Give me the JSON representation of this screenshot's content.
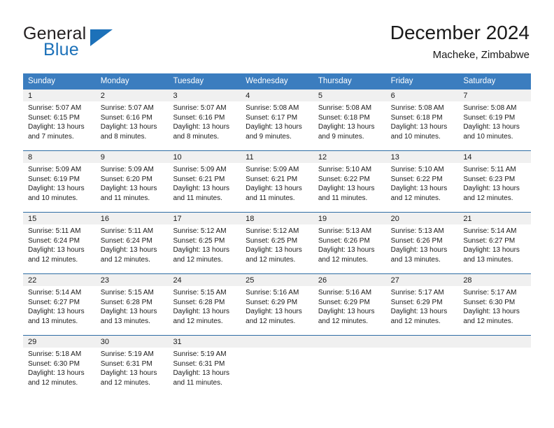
{
  "brand": {
    "name_top": "General",
    "name_bottom": "Blue",
    "triangle_icon": "blue-triangle-logo",
    "colors": {
      "blue": "#1c71b9",
      "black": "#231f20"
    }
  },
  "header": {
    "title": "December 2024",
    "subtitle": "Macheke, Zimbabwe"
  },
  "calendar": {
    "colors": {
      "header_blue": "#3b7dbf",
      "row_divider_blue": "#2e6da4",
      "day_band_gray": "#f0f0f0"
    },
    "weekdays": [
      "Sunday",
      "Monday",
      "Tuesday",
      "Wednesday",
      "Thursday",
      "Friday",
      "Saturday"
    ],
    "weeks": [
      [
        {
          "day": "1",
          "sunrise": "Sunrise: 5:07 AM",
          "sunset": "Sunset: 6:15 PM",
          "daylight_line1": "Daylight: 13 hours",
          "daylight_line2": "and 7 minutes."
        },
        {
          "day": "2",
          "sunrise": "Sunrise: 5:07 AM",
          "sunset": "Sunset: 6:16 PM",
          "daylight_line1": "Daylight: 13 hours",
          "daylight_line2": "and 8 minutes."
        },
        {
          "day": "3",
          "sunrise": "Sunrise: 5:07 AM",
          "sunset": "Sunset: 6:16 PM",
          "daylight_line1": "Daylight: 13 hours",
          "daylight_line2": "and 8 minutes."
        },
        {
          "day": "4",
          "sunrise": "Sunrise: 5:08 AM",
          "sunset": "Sunset: 6:17 PM",
          "daylight_line1": "Daylight: 13 hours",
          "daylight_line2": "and 9 minutes."
        },
        {
          "day": "5",
          "sunrise": "Sunrise: 5:08 AM",
          "sunset": "Sunset: 6:18 PM",
          "daylight_line1": "Daylight: 13 hours",
          "daylight_line2": "and 9 minutes."
        },
        {
          "day": "6",
          "sunrise": "Sunrise: 5:08 AM",
          "sunset": "Sunset: 6:18 PM",
          "daylight_line1": "Daylight: 13 hours",
          "daylight_line2": "and 10 minutes."
        },
        {
          "day": "7",
          "sunrise": "Sunrise: 5:08 AM",
          "sunset": "Sunset: 6:19 PM",
          "daylight_line1": "Daylight: 13 hours",
          "daylight_line2": "and 10 minutes."
        }
      ],
      [
        {
          "day": "8",
          "sunrise": "Sunrise: 5:09 AM",
          "sunset": "Sunset: 6:19 PM",
          "daylight_line1": "Daylight: 13 hours",
          "daylight_line2": "and 10 minutes."
        },
        {
          "day": "9",
          "sunrise": "Sunrise: 5:09 AM",
          "sunset": "Sunset: 6:20 PM",
          "daylight_line1": "Daylight: 13 hours",
          "daylight_line2": "and 11 minutes."
        },
        {
          "day": "10",
          "sunrise": "Sunrise: 5:09 AM",
          "sunset": "Sunset: 6:21 PM",
          "daylight_line1": "Daylight: 13 hours",
          "daylight_line2": "and 11 minutes."
        },
        {
          "day": "11",
          "sunrise": "Sunrise: 5:09 AM",
          "sunset": "Sunset: 6:21 PM",
          "daylight_line1": "Daylight: 13 hours",
          "daylight_line2": "and 11 minutes."
        },
        {
          "day": "12",
          "sunrise": "Sunrise: 5:10 AM",
          "sunset": "Sunset: 6:22 PM",
          "daylight_line1": "Daylight: 13 hours",
          "daylight_line2": "and 11 minutes."
        },
        {
          "day": "13",
          "sunrise": "Sunrise: 5:10 AM",
          "sunset": "Sunset: 6:22 PM",
          "daylight_line1": "Daylight: 13 hours",
          "daylight_line2": "and 12 minutes."
        },
        {
          "day": "14",
          "sunrise": "Sunrise: 5:11 AM",
          "sunset": "Sunset: 6:23 PM",
          "daylight_line1": "Daylight: 13 hours",
          "daylight_line2": "and 12 minutes."
        }
      ],
      [
        {
          "day": "15",
          "sunrise": "Sunrise: 5:11 AM",
          "sunset": "Sunset: 6:24 PM",
          "daylight_line1": "Daylight: 13 hours",
          "daylight_line2": "and 12 minutes."
        },
        {
          "day": "16",
          "sunrise": "Sunrise: 5:11 AM",
          "sunset": "Sunset: 6:24 PM",
          "daylight_line1": "Daylight: 13 hours",
          "daylight_line2": "and 12 minutes."
        },
        {
          "day": "17",
          "sunrise": "Sunrise: 5:12 AM",
          "sunset": "Sunset: 6:25 PM",
          "daylight_line1": "Daylight: 13 hours",
          "daylight_line2": "and 12 minutes."
        },
        {
          "day": "18",
          "sunrise": "Sunrise: 5:12 AM",
          "sunset": "Sunset: 6:25 PM",
          "daylight_line1": "Daylight: 13 hours",
          "daylight_line2": "and 12 minutes."
        },
        {
          "day": "19",
          "sunrise": "Sunrise: 5:13 AM",
          "sunset": "Sunset: 6:26 PM",
          "daylight_line1": "Daylight: 13 hours",
          "daylight_line2": "and 12 minutes."
        },
        {
          "day": "20",
          "sunrise": "Sunrise: 5:13 AM",
          "sunset": "Sunset: 6:26 PM",
          "daylight_line1": "Daylight: 13 hours",
          "daylight_line2": "and 13 minutes."
        },
        {
          "day": "21",
          "sunrise": "Sunrise: 5:14 AM",
          "sunset": "Sunset: 6:27 PM",
          "daylight_line1": "Daylight: 13 hours",
          "daylight_line2": "and 13 minutes."
        }
      ],
      [
        {
          "day": "22",
          "sunrise": "Sunrise: 5:14 AM",
          "sunset": "Sunset: 6:27 PM",
          "daylight_line1": "Daylight: 13 hours",
          "daylight_line2": "and 13 minutes."
        },
        {
          "day": "23",
          "sunrise": "Sunrise: 5:15 AM",
          "sunset": "Sunset: 6:28 PM",
          "daylight_line1": "Daylight: 13 hours",
          "daylight_line2": "and 13 minutes."
        },
        {
          "day": "24",
          "sunrise": "Sunrise: 5:15 AM",
          "sunset": "Sunset: 6:28 PM",
          "daylight_line1": "Daylight: 13 hours",
          "daylight_line2": "and 12 minutes."
        },
        {
          "day": "25",
          "sunrise": "Sunrise: 5:16 AM",
          "sunset": "Sunset: 6:29 PM",
          "daylight_line1": "Daylight: 13 hours",
          "daylight_line2": "and 12 minutes."
        },
        {
          "day": "26",
          "sunrise": "Sunrise: 5:16 AM",
          "sunset": "Sunset: 6:29 PM",
          "daylight_line1": "Daylight: 13 hours",
          "daylight_line2": "and 12 minutes."
        },
        {
          "day": "27",
          "sunrise": "Sunrise: 5:17 AM",
          "sunset": "Sunset: 6:29 PM",
          "daylight_line1": "Daylight: 13 hours",
          "daylight_line2": "and 12 minutes."
        },
        {
          "day": "28",
          "sunrise": "Sunrise: 5:17 AM",
          "sunset": "Sunset: 6:30 PM",
          "daylight_line1": "Daylight: 13 hours",
          "daylight_line2": "and 12 minutes."
        }
      ],
      [
        {
          "day": "29",
          "sunrise": "Sunrise: 5:18 AM",
          "sunset": "Sunset: 6:30 PM",
          "daylight_line1": "Daylight: 13 hours",
          "daylight_line2": "and 12 minutes."
        },
        {
          "day": "30",
          "sunrise": "Sunrise: 5:19 AM",
          "sunset": "Sunset: 6:31 PM",
          "daylight_line1": "Daylight: 13 hours",
          "daylight_line2": "and 12 minutes."
        },
        {
          "day": "31",
          "sunrise": "Sunrise: 5:19 AM",
          "sunset": "Sunset: 6:31 PM",
          "daylight_line1": "Daylight: 13 hours",
          "daylight_line2": "and 11 minutes."
        },
        {
          "day": "",
          "sunrise": "",
          "sunset": "",
          "daylight_line1": "",
          "daylight_line2": ""
        },
        {
          "day": "",
          "sunrise": "",
          "sunset": "",
          "daylight_line1": "",
          "daylight_line2": ""
        },
        {
          "day": "",
          "sunrise": "",
          "sunset": "",
          "daylight_line1": "",
          "daylight_line2": ""
        },
        {
          "day": "",
          "sunrise": "",
          "sunset": "",
          "daylight_line1": "",
          "daylight_line2": ""
        }
      ]
    ]
  }
}
